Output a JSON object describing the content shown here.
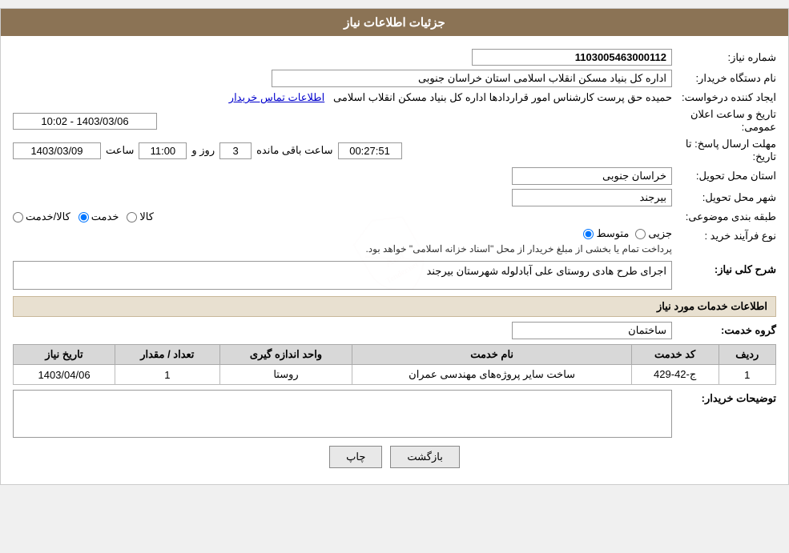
{
  "page": {
    "title": "جزئیات اطلاعات نیاز",
    "sections": {
      "header": "جزئیات اطلاعات نیاز",
      "services_header": "اطلاعات خدمات مورد نیاز"
    }
  },
  "fields": {
    "need_number_label": "شماره نیاز:",
    "need_number_value": "1103005463000112",
    "buyer_org_label": "نام دستگاه خریدار:",
    "buyer_org_value": "اداره کل بنیاد مسکن انقلاب اسلامی استان خراسان جنوبی",
    "creator_label": "ایجاد کننده درخواست:",
    "creator_value": "حمیده حق پرست کارشناس امور قراردادها اداره کل بنیاد مسکن انقلاب اسلامی",
    "creator_link": "اطلاعات تماس خریدار",
    "announce_label": "تاریخ و ساعت اعلان عمومی:",
    "announce_value": "1403/03/06 - 10:02",
    "deadline_label": "مهلت ارسال پاسخ: تا تاریخ:",
    "deadline_date": "1403/03/09",
    "deadline_time_label": "ساعت",
    "deadline_time": "11:00",
    "deadline_days_label": "روز و",
    "deadline_days": "3",
    "deadline_remaining_label": "ساعت باقی مانده",
    "deadline_remaining": "00:27:51",
    "province_label": "استان محل تحویل:",
    "province_value": "خراسان جنوبی",
    "city_label": "شهر محل تحویل:",
    "city_value": "بیرجند",
    "category_label": "طبقه بندی موضوعی:",
    "category_options": [
      "کالا",
      "خدمت",
      "کالا/خدمت"
    ],
    "category_selected": "خدمت",
    "purchase_label": "نوع فرآیند خرید :",
    "purchase_options": [
      "جزیی",
      "متوسط"
    ],
    "purchase_selected": "متوسط",
    "purchase_note": "پرداخت تمام یا بخشی از مبلغ خریدار از محل \"اسناد خزانه اسلامی\" خواهد بود.",
    "description_label": "شرح کلی نیاز:",
    "description_value": "اجرای طرح هادی روستای علی آبادلوله شهرستان بیرجند",
    "service_group_label": "گروه خدمت:",
    "service_group_value": "ساختمان",
    "buyer_notes_label": "توضیحات خریدار:",
    "buyer_notes_value": ""
  },
  "services_table": {
    "columns": [
      "ردیف",
      "کد خدمت",
      "نام خدمت",
      "واحد اندازه گیری",
      "تعداد / مقدار",
      "تاریخ نیاز"
    ],
    "rows": [
      {
        "row": "1",
        "code": "ج-42-429",
        "name": "ساخت سایر پروژه‌های مهندسی عمران",
        "unit": "روستا",
        "quantity": "1",
        "date": "1403/04/06"
      }
    ]
  },
  "buttons": {
    "print": "چاپ",
    "back": "بازگشت"
  }
}
